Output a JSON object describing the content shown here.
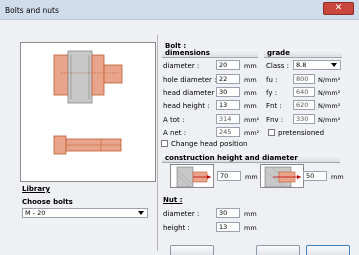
{
  "window": {
    "title": "Bolts and nuts",
    "close_glyph": "✕"
  },
  "library": {
    "heading": "Library",
    "choose_label": "Choose bolts",
    "selected": "M - 20"
  },
  "bolt": {
    "heading": "Bolt :",
    "dimensions_header": "dimensions",
    "grade_header": "grade",
    "rows": [
      {
        "label": "diameter :",
        "value": "20",
        "unit": "mm"
      },
      {
        "label": "hole diameter :",
        "value": "22",
        "unit": "mm"
      },
      {
        "label": "head diameter :",
        "value": "30",
        "unit": "mm"
      },
      {
        "label": "head height :",
        "value": "13",
        "unit": "mm"
      },
      {
        "label": "A tot :",
        "value": "314",
        "unit": "mm²"
      },
      {
        "label": "A net :",
        "value": "245",
        "unit": "mm²"
      }
    ],
    "class_label": "Class :",
    "class_value": "8.8",
    "grade_rows": [
      {
        "label": "fu :",
        "value": "800",
        "unit": "N/mm²"
      },
      {
        "label": "fy :",
        "value": "640",
        "unit": "N/mm²"
      },
      {
        "label": "Fnt :",
        "value": "620",
        "unit": "N/mm²"
      },
      {
        "label": "Fnv :",
        "value": "330",
        "unit": "N/mm²"
      }
    ],
    "pretensioned_label": "pretensioned",
    "change_head_label": "Change head position"
  },
  "construction": {
    "header": "construction height and diameter",
    "height_value": "70",
    "diameter_value": "50",
    "unit": "mm"
  },
  "nut": {
    "heading": "Nut :",
    "rows": [
      {
        "label": "diameter :",
        "value": "30",
        "unit": "mm"
      },
      {
        "label": "height :",
        "value": "13",
        "unit": "mm"
      }
    ]
  },
  "colors": {
    "bolt_fill": "#e8a58b",
    "bolt_stroke": "#c0582e",
    "plate_fill": "#c8c8c8"
  }
}
